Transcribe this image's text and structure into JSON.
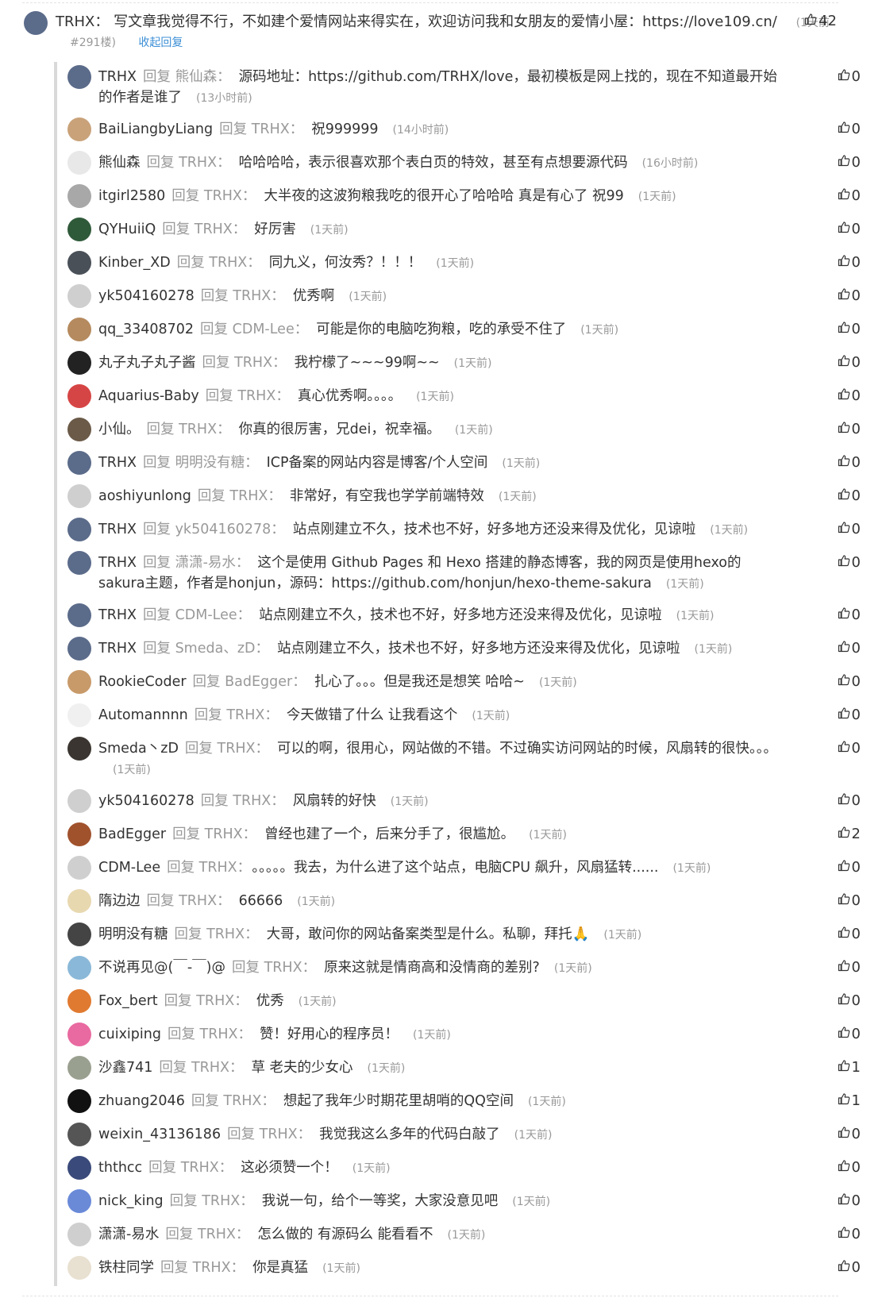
{
  "main": {
    "user": "TRHX",
    "content": "写文章我觉得不行，不如建个爱情网站来得实在，欢迎访问我和女朋友的爱情小屋：https://love109.cn/",
    "time": "(1天前",
    "floor": "#291楼)",
    "collapse_label": "收起回复",
    "likes": "42",
    "avatar_color": "#5b6b8a"
  },
  "reply_verb": "回复",
  "replies": [
    {
      "user": "TRHX",
      "target": "熊仙森",
      "content": "源码地址：https://github.com/TRHX/love，最初模板是网上找的，现在不知道最开始的作者是谁了",
      "time": "(13小时前)",
      "likes": "0",
      "avatar_color": "#5b6b8a"
    },
    {
      "user": "BaiLiangbyLiang",
      "target": "TRHX",
      "content": "祝999999",
      "time": "(14小时前)",
      "likes": "0",
      "avatar_color": "#c9a27a"
    },
    {
      "user": "熊仙森",
      "target": "TRHX",
      "content": "哈哈哈哈，表示很喜欢那个表白页的特效，甚至有点想要源代码",
      "time": "(16小时前)",
      "likes": "0",
      "avatar_color": "#e8e8e8"
    },
    {
      "user": "itgirl2580",
      "target": "TRHX",
      "content": "大半夜的这波狗粮我吃的很开心了哈哈哈 真是有心了 祝99",
      "time": "(1天前)",
      "likes": "0",
      "avatar_color": "#a8a8a8"
    },
    {
      "user": "QYHuiiQ",
      "target": "TRHX",
      "content": "好厉害",
      "time": "(1天前)",
      "likes": "0",
      "avatar_color": "#2f5a3a"
    },
    {
      "user": "Kinber_XD",
      "target": "TRHX",
      "content": "同九义，何汝秀？！！！",
      "time": "(1天前)",
      "likes": "0",
      "avatar_color": "#4a5058"
    },
    {
      "user": "yk504160278",
      "target": "TRHX",
      "content": "优秀啊",
      "time": "(1天前)",
      "likes": "0",
      "avatar_color": "#cfcfcf"
    },
    {
      "user": "qq_33408702",
      "target": "CDM-Lee",
      "content": "可能是你的电脑吃狗粮，吃的承受不住了",
      "time": "(1天前)",
      "likes": "0",
      "avatar_color": "#b58a5e"
    },
    {
      "user": "丸子丸子丸子酱",
      "target": "TRHX",
      "content": "我柠檬了~~~99啊~~",
      "time": "(1天前)",
      "likes": "0",
      "avatar_color": "#222222"
    },
    {
      "user": "Aquarius-Baby",
      "target": "TRHX",
      "content": "真心优秀啊。。。。",
      "time": "(1天前)",
      "likes": "0",
      "avatar_color": "#d64545"
    },
    {
      "user": "小仙。",
      "target": "TRHX",
      "content": "你真的很厉害，兄dei，祝幸福。",
      "time": "(1天前)",
      "likes": "0",
      "avatar_color": "#6b5a48"
    },
    {
      "user": "TRHX",
      "target": "明明没有糖",
      "content": "ICP备案的网站内容是博客/个人空间",
      "time": "(1天前)",
      "likes": "0",
      "avatar_color": "#5b6b8a"
    },
    {
      "user": "aoshiyunlong",
      "target": "TRHX",
      "content": "非常好，有空我也学学前端特效",
      "time": "(1天前)",
      "likes": "0",
      "avatar_color": "#cfcfcf"
    },
    {
      "user": "TRHX",
      "target": "yk504160278",
      "content": "站点刚建立不久，技术也不好，好多地方还没来得及优化，见谅啦",
      "time": "(1天前)",
      "likes": "0",
      "avatar_color": "#5b6b8a"
    },
    {
      "user": "TRHX",
      "target": "潇潇-易水",
      "content": "这个是使用 Github Pages 和 Hexo 搭建的静态博客，我的网页是使用hexo的sakura主题，作者是honjun，源码：https://github.com/honjun/hexo-theme-sakura",
      "time": "(1天前)",
      "likes": "0",
      "avatar_color": "#5b6b8a"
    },
    {
      "user": "TRHX",
      "target": "CDM-Lee",
      "content": "站点刚建立不久，技术也不好，好多地方还没来得及优化，见谅啦",
      "time": "(1天前)",
      "likes": "0",
      "avatar_color": "#5b6b8a"
    },
    {
      "user": "TRHX",
      "target": "Smeda、zD",
      "content": "站点刚建立不久，技术也不好，好多地方还没来得及优化，见谅啦",
      "time": "(1天前)",
      "likes": "0",
      "avatar_color": "#5b6b8a"
    },
    {
      "user": "RookieCoder",
      "target": "BadEgger",
      "content": "扎心了。。。但是我还是想笑 哈哈~",
      "time": "(1天前)",
      "likes": "0",
      "avatar_color": "#c89a6a"
    },
    {
      "user": "Automannnn",
      "target": "TRHX",
      "content": "今天做错了什么 让我看这个",
      "time": "(1天前)",
      "likes": "0",
      "avatar_color": "#f0f0f0"
    },
    {
      "user": "Smeda丶zD",
      "target": "TRHX",
      "content": "可以的啊，很用心，网站做的不错。不过确实访问网站的时候，风扇转的很快。。。",
      "time": "(1天前)",
      "likes": "0",
      "avatar_color": "#3a3530"
    },
    {
      "user": "yk504160278",
      "target": "TRHX",
      "content": "风扇转的好快",
      "time": "(1天前)",
      "likes": "0",
      "avatar_color": "#cfcfcf"
    },
    {
      "user": "BadEgger",
      "target": "TRHX",
      "content": "曾经也建了一个，后来分手了，很尴尬。",
      "time": "(1天前)",
      "likes": "2",
      "avatar_color": "#a0522d"
    },
    {
      "user": "CDM-Lee",
      "target": "TRHX",
      "content": "。。。。。我去，为什么进了这个站点，电脑CPU 飙升，风扇猛转......",
      "time": "(1天前)",
      "likes": "0",
      "avatar_color": "#cfcfcf"
    },
    {
      "user": "隋边边",
      "target": "TRHX",
      "content": "66666",
      "time": "(1天前)",
      "likes": "0",
      "avatar_color": "#e8d8b0"
    },
    {
      "user": "明明没有糖",
      "target": "TRHX",
      "content": "大哥，敢问你的网站备案类型是什么。私聊，拜托🙏",
      "time": "(1天前)",
      "likes": "0",
      "avatar_color": "#444444"
    },
    {
      "user": "不说再见@(￣-￣)@",
      "target": "TRHX",
      "content": "原来这就是情商高和没情商的差别?",
      "time": "(1天前)",
      "likes": "0",
      "avatar_color": "#8ab8d8"
    },
    {
      "user": "Fox_bert",
      "target": "TRHX",
      "content": "优秀",
      "time": "(1天前)",
      "likes": "0",
      "avatar_color": "#e07a30"
    },
    {
      "user": "cuixiping",
      "target": "TRHX",
      "content": "赞！好用心的程序员！",
      "time": "(1天前)",
      "likes": "0",
      "avatar_color": "#e86aa0"
    },
    {
      "user": "沙鑫741",
      "target": "TRHX",
      "content": "草 老夫的少女心",
      "time": "(1天前)",
      "likes": "1",
      "avatar_color": "#9aa090"
    },
    {
      "user": "zhuang2046",
      "target": "TRHX",
      "content": "想起了我年少时期花里胡哨的QQ空间",
      "time": "(1天前)",
      "likes": "1",
      "avatar_color": "#111111"
    },
    {
      "user": "weixin_43136186",
      "target": "TRHX",
      "content": "我觉我这么多年的代码白敲了",
      "time": "(1天前)",
      "likes": "0",
      "avatar_color": "#555555"
    },
    {
      "user": "ththcc",
      "target": "TRHX",
      "content": "这必须赞一个！",
      "time": "(1天前)",
      "likes": "0",
      "avatar_color": "#3a4a7a"
    },
    {
      "user": "nick_king",
      "target": "TRHX",
      "content": "我说一句，给个一等奖，大家没意见吧",
      "time": "(1天前)",
      "likes": "0",
      "avatar_color": "#6a8ad8"
    },
    {
      "user": "潇潇-易水",
      "target": "TRHX",
      "content": "怎么做的 有源码么 能看看不",
      "time": "(1天前)",
      "likes": "0",
      "avatar_color": "#cfcfcf"
    },
    {
      "user": "铁柱同学",
      "target": "TRHX",
      "content": "你是真猛",
      "time": "(1天前)",
      "likes": "0",
      "avatar_color": "#e8e0d0"
    }
  ]
}
